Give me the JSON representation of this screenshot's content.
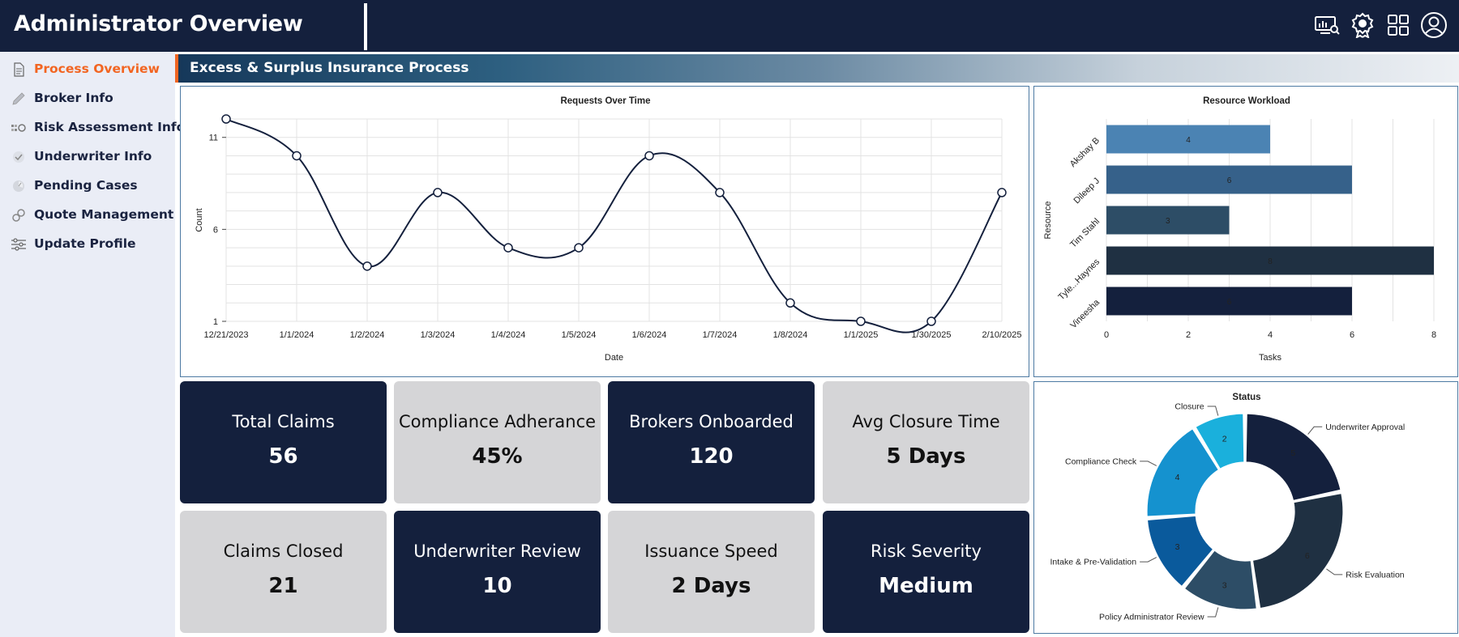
{
  "app": {
    "title": "Administrator Overview"
  },
  "header_icons": [
    "monitor-search-icon",
    "award-badge-icon",
    "apps-grid-icon",
    "user-account-icon"
  ],
  "sidebar": {
    "items": [
      {
        "label": "Process Overview",
        "icon": "document-icon",
        "active": true
      },
      {
        "label": "Broker Info",
        "icon": "pencil-icon",
        "active": false
      },
      {
        "label": "Risk Assessment Info",
        "icon": "risk-tiles-icon",
        "active": false
      },
      {
        "label": "Underwriter Info",
        "icon": "check-circle-icon",
        "active": false
      },
      {
        "label": "Pending Cases",
        "icon": "timer-icon",
        "active": false
      },
      {
        "label": "Quote Management",
        "icon": "link-icon",
        "active": false
      },
      {
        "label": "Update Profile",
        "icon": "sliders-icon",
        "active": false
      }
    ]
  },
  "section": {
    "title": "Excess & Surplus Insurance Process"
  },
  "kpis": [
    {
      "label": "Total Claims",
      "value": "56",
      "style": "dark"
    },
    {
      "label": "Compliance Adherance",
      "value": "45%",
      "style": "light"
    },
    {
      "label": "Brokers Onboarded",
      "value": "120",
      "style": "dark"
    },
    {
      "label": "Avg Closure Time",
      "value": "5 Days",
      "style": "light"
    },
    {
      "label": "Claims Closed",
      "value": "21",
      "style": "light"
    },
    {
      "label": "Underwriter Review",
      "value": "10",
      "style": "dark"
    },
    {
      "label": "Issuance Speed",
      "value": "2 Days",
      "style": "light"
    },
    {
      "label": "Risk Severity",
      "value": "Medium",
      "style": "dark"
    }
  ],
  "colors": {
    "navy": "#14203d",
    "accent": "#f26522",
    "tile_light": "#d5d5d7",
    "panel_border": "#4d7aa3"
  },
  "chart_data": [
    {
      "type": "line",
      "title": "Requests Over Time",
      "xlabel": "Date",
      "ylabel": "Count",
      "x": [
        "12/21/2023",
        "1/1/2024",
        "1/2/2024",
        "1/3/2024",
        "1/4/2024",
        "1/5/2024",
        "1/6/2024",
        "1/7/2024",
        "1/8/2024",
        "1/1/2025",
        "1/30/2025",
        "2/10/2025"
      ],
      "y": [
        12,
        10,
        4,
        8,
        5,
        5,
        10,
        8,
        2,
        1,
        1,
        8
      ],
      "yticks": [
        1,
        6,
        11
      ],
      "ylim": [
        1,
        12
      ],
      "grid": true,
      "color": "#14203d"
    },
    {
      "type": "bar",
      "orientation": "horizontal",
      "title": "Resource Workload",
      "xlabel": "Tasks",
      "ylabel": "Resource",
      "categories": [
        "Akshay B",
        "Dileep J",
        "Tim Stahl",
        "Tyle...Haynes",
        "Vineesha"
      ],
      "values": [
        4,
        6,
        3,
        8,
        6
      ],
      "colors": [
        "#4b83b3",
        "#36618a",
        "#2d4d66",
        "#1f3042",
        "#14203d"
      ],
      "xticks": [
        0,
        2,
        4,
        6,
        8
      ],
      "xlim": [
        0,
        8
      ],
      "grid": true
    },
    {
      "type": "pie",
      "title": "Status",
      "donut": true,
      "labels": [
        "Underwriter Approval",
        "Risk Evaluation",
        "Policy Administrator Review",
        "Intake & Pre-Validation",
        "Compliance Check",
        "Closure"
      ],
      "values": [
        5,
        6,
        3,
        3,
        4,
        2
      ],
      "colors": [
        "#14203d",
        "#1f3042",
        "#2d4d66",
        "#0a5a9c",
        "#1592cf",
        "#1ab0dc"
      ]
    }
  ]
}
